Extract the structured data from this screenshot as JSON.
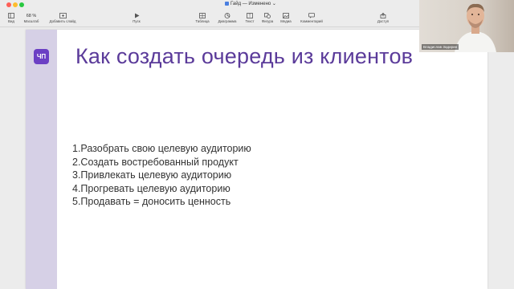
{
  "window": {
    "title": "Гайд — Изменено"
  },
  "toolbar": {
    "view_label": "Вид",
    "zoom_value": "68 %",
    "zoom_label": "Масштаб",
    "add_slide_label": "Добавить слайд",
    "play_label": "Пуск",
    "table_label": "Таблица",
    "chart_label": "Диаграмма",
    "text_label": "Текст",
    "shape_label": "Фигура",
    "media_label": "Медиа",
    "comment_label": "Комментарий",
    "share_label": "Доступ"
  },
  "slide": {
    "logo_text": "ЧП",
    "title": "Как создать очередь из клиентов",
    "items": [
      "1.Разобрать свою целевую аудиторию",
      "2.Создать востребованный продукт",
      "3.Привлекать целевую аудиторию",
      "4.Прогревать целевую аудиторию",
      "5.Продавать = доносить ценность"
    ]
  },
  "webcam": {
    "name": "Владислав Задирин"
  },
  "colors": {
    "accent": "#6b3fc4",
    "title_text": "#5b3b9a",
    "side_band": "#d6d0e6"
  }
}
